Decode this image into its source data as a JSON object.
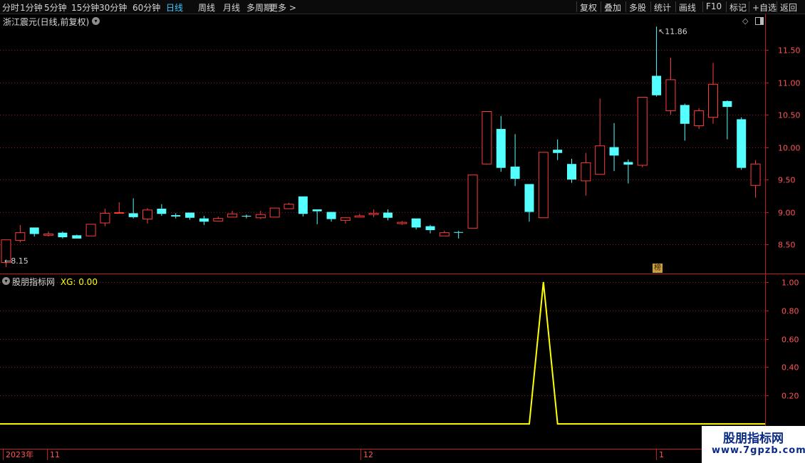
{
  "toolbar": {
    "periods": [
      "分时",
      "1分钟",
      "5分钟",
      "15分钟",
      "30分钟",
      "60分钟",
      "日线",
      "周线",
      "月线",
      "多周期",
      "更多 >"
    ],
    "active_period": "日线",
    "right_buttons": [
      "复权",
      "叠加",
      "多股",
      "统计",
      "画线",
      "F10",
      "标记",
      "+自选",
      "返回"
    ]
  },
  "main_panel": {
    "title": "浙江震元(日线,前复权)",
    "high_label": "11.86",
    "low_label": "8.15",
    "event_badge": "榜"
  },
  "indicator_panel": {
    "name": "股朋指标网",
    "series_label": "XG:",
    "series_value": "0.00"
  },
  "x_axis": {
    "labels": [
      "2023年",
      "11",
      "12",
      "1"
    ]
  },
  "watermark": {
    "line1": "股朋指标网",
    "line2": "www.7gpzb.com"
  },
  "colors": {
    "up": "#ff3b3b",
    "down": "#54ffff",
    "grid": "#8a1818",
    "indicator": "#ffff00",
    "axis_text": "#ff5555"
  },
  "chart_data": [
    {
      "type": "candlestick",
      "title": "浙江震元(日线,前复权)",
      "y_ticks": [
        8.5,
        9.0,
        9.5,
        10.0,
        10.5,
        11.0,
        11.5
      ],
      "ylim": [
        8.05,
        12.05
      ],
      "grid": true,
      "candles": [
        [
          8.22,
          8.57,
          8.15,
          8.57
        ],
        [
          8.56,
          8.68,
          8.53,
          8.8
        ],
        [
          8.76,
          8.66,
          8.62,
          8.76
        ],
        [
          8.64,
          8.66,
          8.62,
          8.7
        ],
        [
          8.68,
          8.61,
          8.59,
          8.7
        ],
        [
          8.64,
          8.59,
          8.59,
          8.65
        ],
        [
          8.63,
          8.81,
          8.63,
          8.81
        ],
        [
          8.83,
          8.98,
          8.78,
          9.05
        ],
        [
          8.98,
          8.99,
          8.98,
          9.15
        ],
        [
          8.98,
          8.92,
          8.9,
          9.21
        ],
        [
          8.89,
          9.03,
          8.82,
          9.06
        ],
        [
          9.05,
          8.97,
          8.94,
          9.12
        ],
        [
          8.95,
          8.93,
          8.9,
          8.98
        ],
        [
          8.99,
          8.91,
          8.88,
          8.99
        ],
        [
          8.9,
          8.85,
          8.8,
          8.94
        ],
        [
          8.86,
          8.9,
          8.86,
          8.93
        ],
        [
          8.92,
          8.97,
          8.92,
          9.02
        ],
        [
          8.94,
          8.93,
          8.9,
          8.96
        ],
        [
          8.91,
          8.96,
          8.89,
          9.02
        ],
        [
          8.92,
          9.06,
          8.92,
          9.06
        ],
        [
          9.05,
          9.12,
          9.05,
          9.14
        ],
        [
          9.24,
          8.97,
          8.93,
          9.24
        ],
        [
          9.04,
          9.01,
          8.81,
          9.04
        ],
        [
          9.0,
          8.89,
          8.85,
          9.0
        ],
        [
          8.87,
          8.91,
          8.82,
          8.91
        ],
        [
          8.92,
          8.94,
          8.92,
          8.97
        ],
        [
          8.96,
          8.98,
          8.92,
          9.04
        ],
        [
          8.99,
          8.91,
          8.87,
          9.04
        ],
        [
          8.82,
          8.84,
          8.8,
          8.86
        ],
        [
          8.9,
          8.76,
          8.73,
          8.9
        ],
        [
          8.78,
          8.72,
          8.67,
          8.8
        ],
        [
          8.63,
          8.68,
          8.63,
          8.71
        ],
        [
          8.69,
          8.68,
          8.59,
          8.71
        ],
        [
          8.75,
          9.57,
          8.75,
          9.57
        ],
        [
          9.74,
          10.55,
          9.73,
          10.55
        ],
        [
          10.28,
          9.68,
          9.62,
          10.48
        ],
        [
          9.7,
          9.51,
          9.4,
          10.2
        ],
        [
          9.43,
          9.0,
          8.85,
          9.43
        ],
        [
          8.91,
          9.92,
          8.91,
          9.92
        ],
        [
          9.96,
          9.91,
          9.8,
          10.12
        ],
        [
          9.74,
          9.5,
          9.45,
          9.82
        ],
        [
          9.48,
          9.76,
          9.25,
          9.91
        ],
        [
          9.58,
          10.02,
          9.58,
          10.75
        ],
        [
          10.0,
          9.87,
          9.63,
          10.37
        ],
        [
          9.77,
          9.73,
          9.44,
          9.81
        ],
        [
          9.72,
          10.77,
          9.69,
          10.77
        ],
        [
          11.1,
          10.8,
          10.78,
          11.86
        ],
        [
          10.56,
          11.04,
          10.5,
          11.38
        ],
        [
          10.65,
          10.36,
          10.1,
          10.67
        ],
        [
          10.33,
          10.56,
          10.28,
          10.6
        ],
        [
          10.46,
          10.97,
          10.36,
          11.3
        ],
        [
          10.71,
          10.62,
          10.12,
          10.72
        ],
        [
          10.43,
          9.68,
          9.65,
          10.46
        ],
        [
          9.41,
          9.74,
          9.22,
          9.8
        ]
      ]
    },
    {
      "type": "line",
      "series": [
        {
          "name": "XG",
          "values": [
            0,
            0,
            0,
            0,
            0,
            0,
            0,
            0,
            0,
            0,
            0,
            0,
            0,
            0,
            0,
            0,
            0,
            0,
            0,
            0,
            0,
            0,
            0,
            0,
            0,
            0,
            0,
            0,
            0,
            0,
            0,
            0,
            0,
            0,
            0,
            0,
            0,
            0,
            1,
            0,
            0,
            0,
            0,
            0,
            0,
            0,
            0,
            0,
            0,
            0,
            0,
            0,
            0,
            0
          ]
        }
      ],
      "y_ticks": [
        0.2,
        0.4,
        0.6,
        0.8,
        1.0
      ],
      "ylim": [
        -0.175,
        1.055
      ],
      "grid": true
    }
  ]
}
